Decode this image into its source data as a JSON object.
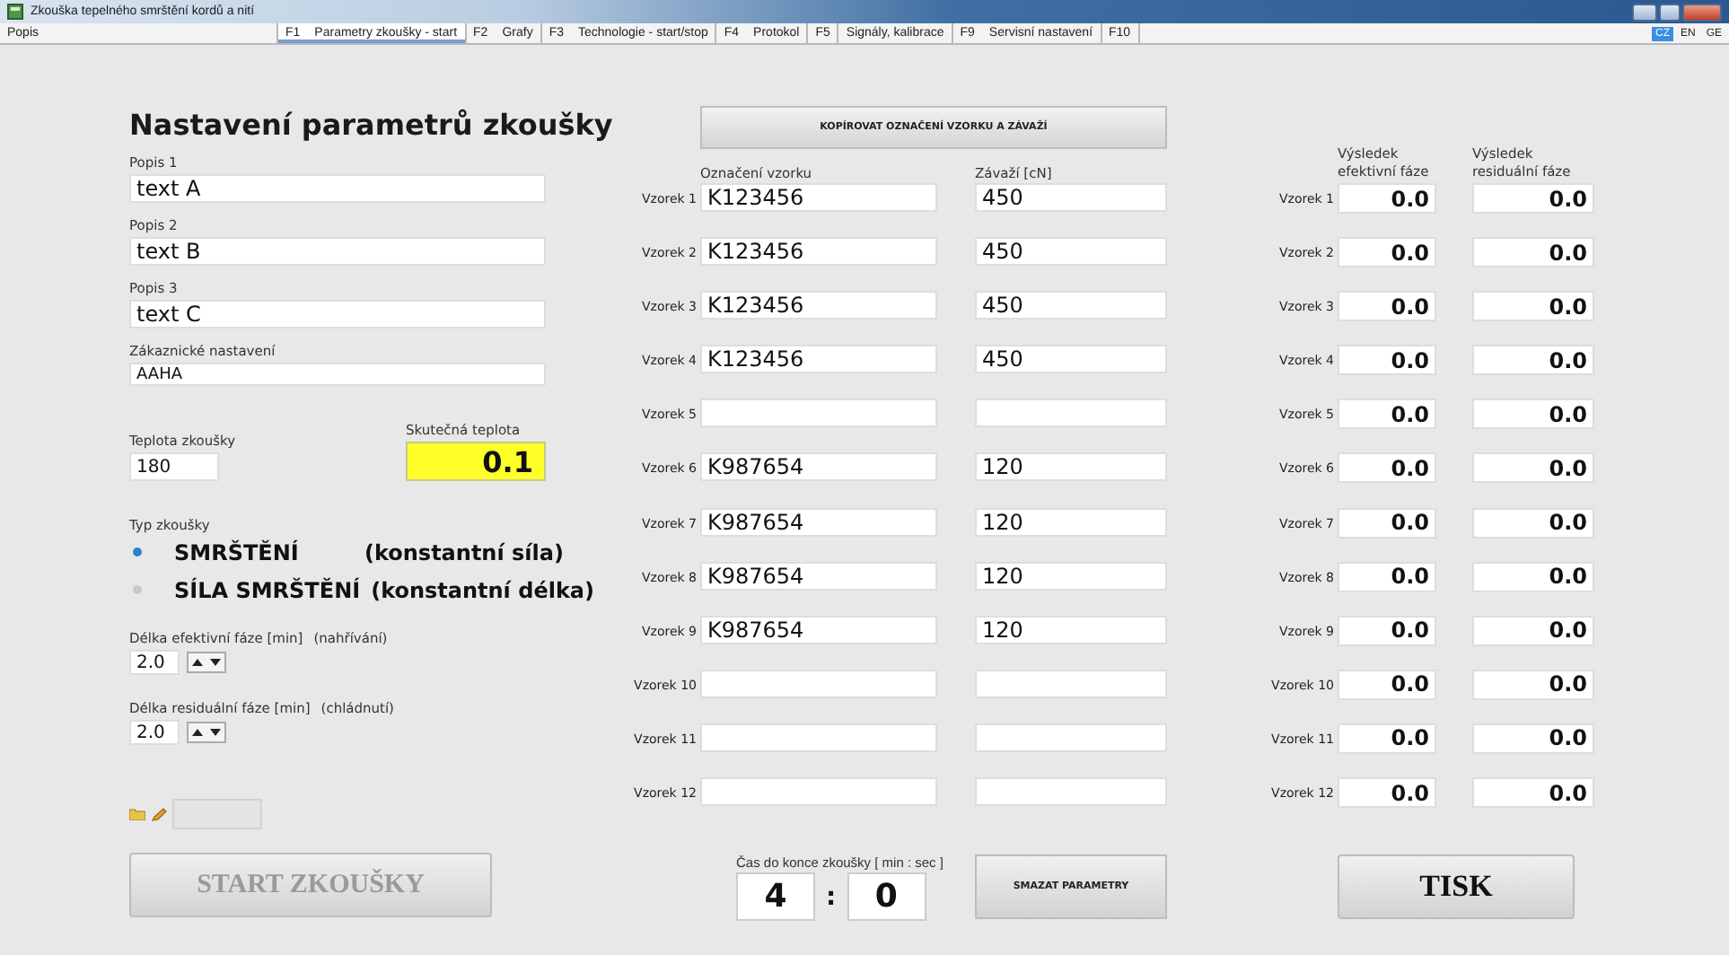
{
  "window": {
    "title": "Zkouška tepelného smrštění kordů a nití"
  },
  "tabs": [
    {
      "label": "Popis",
      "selected": false
    },
    {
      "key": "F1",
      "label": "Parametry zkoušky - start",
      "selected": true
    },
    {
      "key": "F2",
      "label": "Grafy",
      "selected": false
    },
    {
      "key": "F3",
      "label": "Technologie - start/stop",
      "selected": false
    },
    {
      "key": "F4",
      "label": "Protokol",
      "selected": false
    },
    {
      "key": "F5",
      "selected": false
    },
    {
      "label": "Signály, kalibrace",
      "selected": false
    },
    {
      "key": "F9",
      "label": "Servisní nastavení",
      "selected": false
    },
    {
      "key": "F10",
      "selected": false
    }
  ],
  "languages": [
    {
      "label": "CZ",
      "selected": true
    },
    {
      "label": "EN",
      "selected": false
    },
    {
      "label": "GE",
      "selected": false
    }
  ],
  "heading": "Nastavení parametrů zkoušky",
  "descriptions": [
    {
      "label": "Popis 1",
      "value": "text A"
    },
    {
      "label": "Popis 2",
      "value": "text B"
    },
    {
      "label": "Popis 3",
      "value": "text C"
    }
  ],
  "customer_setting": {
    "label": "Zákaznické nastavení",
    "value": "AAHA"
  },
  "test_temperature": {
    "label": "Teplota zkoušky",
    "value": "180"
  },
  "actual_temperature": {
    "label": "Skutečná teplota",
    "value": "0.1"
  },
  "test_type": {
    "label": "Typ zkoušky",
    "options": [
      {
        "name": "SMRŠTĚNÍ",
        "note": "(konstantní síla)",
        "selected": true
      },
      {
        "name": "SÍLA SMRŠTĚNÍ",
        "note": "(konstantní délka)",
        "selected": false
      }
    ]
  },
  "phases": [
    {
      "label": "Délka efektivní fáze [min]",
      "hint": "(nahřívání)",
      "value": "2.0"
    },
    {
      "label": "Délka residuální fáze [min]",
      "hint": "(chládnutí)",
      "value": "2.0"
    }
  ],
  "start_button": {
    "label": "START ZKOUŠKY",
    "disabled": true
  },
  "copy_button": "KOPÍROVAT OZNAČENÍ VZORKU A ZÁVAŽÍ",
  "columns": {
    "sample_id": "Označení vzorku",
    "weight": "Závaží [cN]",
    "effective_result": "Výsledek efektivní fáze",
    "residual_result": "Výsledek residuální fáze"
  },
  "samples": [
    {
      "label": "Vzorek 1",
      "id": "K123456",
      "weight": "450",
      "result_label": "Vzorek 1",
      "effective": "0.0",
      "residual": "0.0"
    },
    {
      "label": "Vzorek 2",
      "id": "K123456",
      "weight": "450",
      "result_label": "Vzorek 2",
      "effective": "0.0",
      "residual": "0.0"
    },
    {
      "label": "Vzorek 3",
      "id": "K123456",
      "weight": "450",
      "result_label": "Vzorek 3",
      "effective": "0.0",
      "residual": "0.0"
    },
    {
      "label": "Vzorek 4",
      "id": "K123456",
      "weight": "450",
      "result_label": "Vzorek 4",
      "effective": "0.0",
      "residual": "0.0"
    },
    {
      "label": "Vzorek 5",
      "result_label": "Vzorek 5",
      "effective": "0.0",
      "residual": "0.0"
    },
    {
      "label": "Vzorek 6",
      "id": "K987654",
      "weight": "120",
      "result_label": "Vzorek 6",
      "effective": "0.0",
      "residual": "0.0"
    },
    {
      "label": "Vzorek 7",
      "id": "K987654",
      "weight": "120",
      "result_label": "Vzorek 7",
      "effective": "0.0",
      "residual": "0.0"
    },
    {
      "label": "Vzorek 8",
      "id": "K987654",
      "weight": "120",
      "result_label": "Vzorek 8",
      "effective": "0.0",
      "residual": "0.0"
    },
    {
      "label": "Vzorek 9",
      "id": "K987654",
      "weight": "120",
      "result_label": "Vzorek 9",
      "effective": "0.0",
      "residual": "0.0"
    },
    {
      "label": "Vzorek 10",
      "result_label": "Vzorek 10",
      "effective": "0.0",
      "residual": "0.0"
    },
    {
      "label": "Vzorek 11",
      "result_label": "Vzorek 11",
      "effective": "0.0",
      "residual": "0.0"
    },
    {
      "label": "Vzorek 12",
      "result_label": "Vzorek 12",
      "effective": "0.0",
      "residual": "0.0"
    }
  ],
  "timer": {
    "label": "Čas do konce zkoušky [ min : sec ]",
    "minutes": "4",
    "separator": ":",
    "seconds": "0"
  },
  "clear_button": "SMAZAT PARAMETRY",
  "print_button": "TISK"
}
